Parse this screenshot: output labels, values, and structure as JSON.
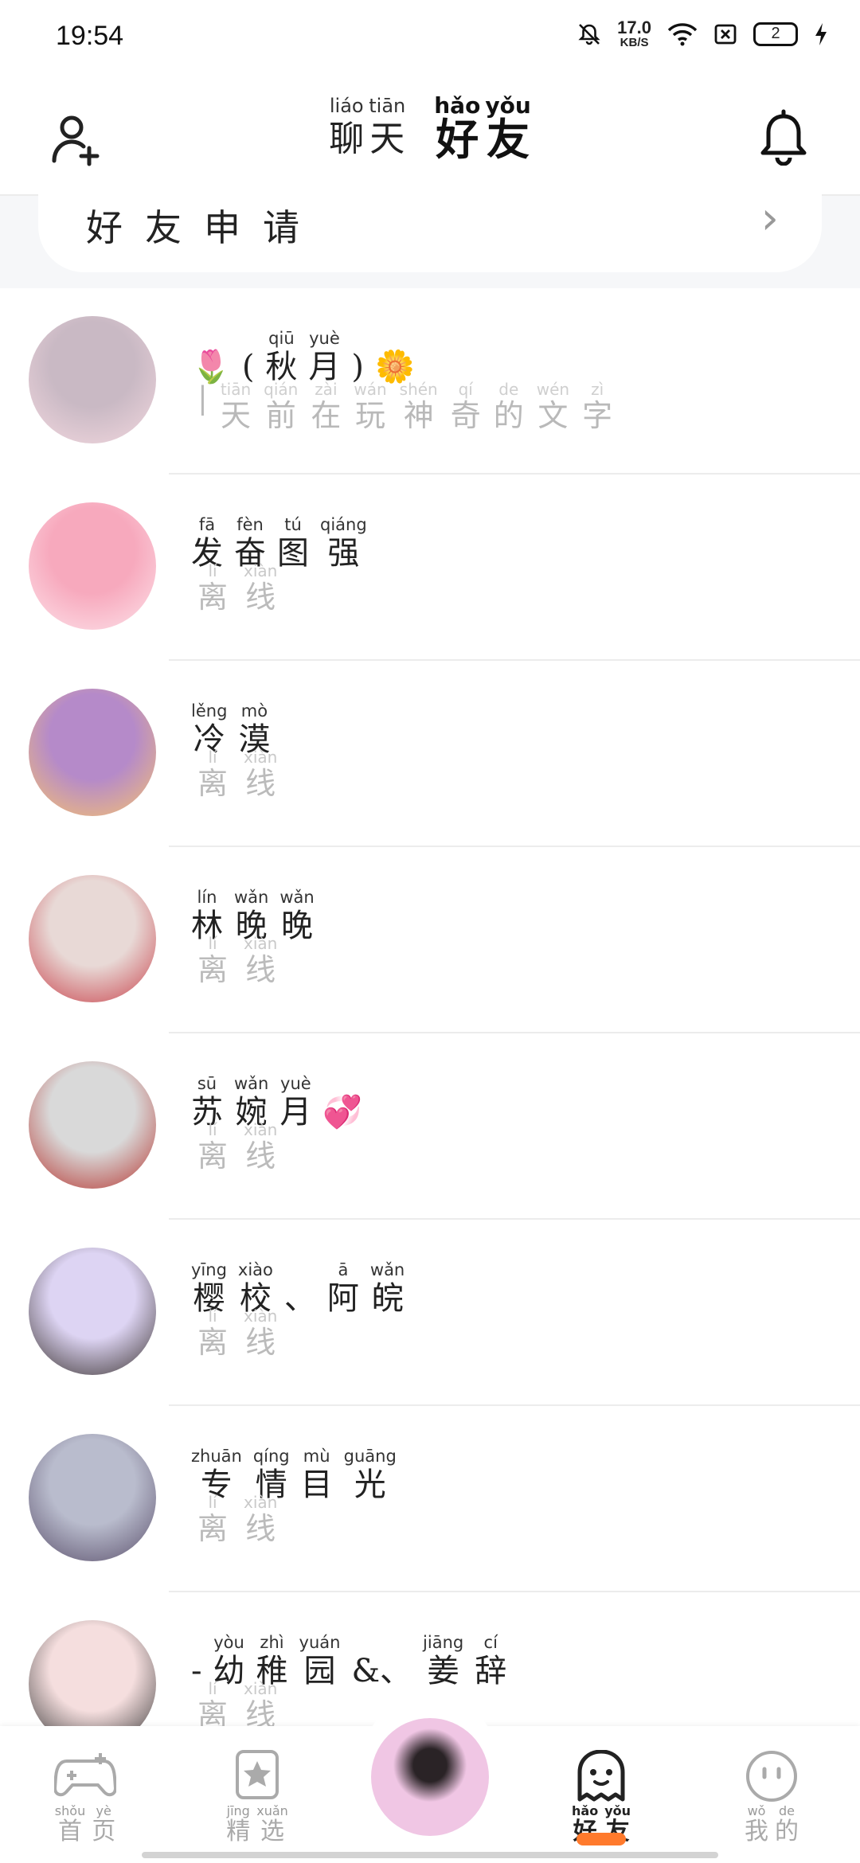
{
  "status_bar": {
    "time": "19:54",
    "net_speed_value": "17.0",
    "net_speed_unit": "KB/S",
    "battery_level": "2",
    "icons": [
      "bell-muted-icon",
      "wifi-icon",
      "sim-off-icon",
      "battery-icon",
      "charging-icon"
    ]
  },
  "header": {
    "tabs": [
      {
        "chars": [
          {
            "py": "liáo",
            "hz": "聊"
          },
          {
            "py": "tiān",
            "hz": "天"
          }
        ],
        "active": false
      },
      {
        "chars": [
          {
            "py": "hǎo",
            "hz": "好"
          },
          {
            "py": "yǒu",
            "hz": "友"
          }
        ],
        "active": true
      }
    ],
    "left_icon": "add-friend-icon",
    "right_icon": "bell-icon",
    "accent_color": "#ff5a1f"
  },
  "friend_request": {
    "label": "好友申请",
    "arrow": "›"
  },
  "friends": [
    {
      "name": [
        {
          "py": "",
          "hz": "🌷"
        },
        {
          "py": "",
          "hz": "("
        },
        {
          "py": "qiū",
          "hz": "秋"
        },
        {
          "py": "yuè",
          "hz": "月"
        },
        {
          "py": "",
          "hz": ")"
        },
        {
          "py": "",
          "hz": "🌼"
        }
      ],
      "status": [
        {
          "py": "",
          "hz": "|"
        },
        {
          "py": "tiān",
          "hz": "天"
        },
        {
          "py": "qián",
          "hz": "前"
        },
        {
          "py": "zài",
          "hz": "在"
        },
        {
          "py": "wán",
          "hz": "玩"
        },
        {
          "py": "shén",
          "hz": "神"
        },
        {
          "py": "qí",
          "hz": "奇"
        },
        {
          "py": "de",
          "hz": "的"
        },
        {
          "py": "wén",
          "hz": "文"
        },
        {
          "py": "zì",
          "hz": "字"
        }
      ],
      "avatar_colors": [
        "#c9b9c4",
        "#f3d8df"
      ]
    },
    {
      "name": [
        {
          "py": "fā",
          "hz": "发"
        },
        {
          "py": "fèn",
          "hz": "奋"
        },
        {
          "py": "tú",
          "hz": "图"
        },
        {
          "py": "qiáng",
          "hz": "强"
        }
      ],
      "status": [
        {
          "py": "lí",
          "hz": "离"
        },
        {
          "py": "xiàn",
          "hz": "线"
        }
      ],
      "avatar_colors": [
        "#f7a9bd",
        "#fde3ea"
      ]
    },
    {
      "name": [
        {
          "py": "lěng",
          "hz": "冷"
        },
        {
          "py": "mò",
          "hz": "漠"
        }
      ],
      "status": [
        {
          "py": "lí",
          "hz": "离"
        },
        {
          "py": "xiàn",
          "hz": "线"
        }
      ],
      "avatar_colors": [
        "#b58ac9",
        "#f6c270"
      ]
    },
    {
      "name": [
        {
          "py": "lín",
          "hz": "林"
        },
        {
          "py": "wǎn",
          "hz": "晚"
        },
        {
          "py": "wǎn",
          "hz": "晚"
        }
      ],
      "status": [
        {
          "py": "lí",
          "hz": "离"
        },
        {
          "py": "xiàn",
          "hz": "线"
        }
      ],
      "avatar_colors": [
        "#e8d9d6",
        "#c8414a"
      ]
    },
    {
      "name": [
        {
          "py": "sū",
          "hz": "苏"
        },
        {
          "py": "wǎn",
          "hz": "婉"
        },
        {
          "py": "yuè",
          "hz": "月"
        },
        {
          "py": "",
          "hz": "💞"
        }
      ],
      "status": [
        {
          "py": "lí",
          "hz": "离"
        },
        {
          "py": "xiàn",
          "hz": "线"
        }
      ],
      "avatar_colors": [
        "#d9d9d9",
        "#b5332e"
      ]
    },
    {
      "name": [
        {
          "py": "yīng",
          "hz": "樱"
        },
        {
          "py": "xiào",
          "hz": "校"
        },
        {
          "py": "",
          "hz": "、"
        },
        {
          "py": "ā",
          "hz": "阿"
        },
        {
          "py": "wǎn",
          "hz": "皖"
        }
      ],
      "status": [
        {
          "py": "lí",
          "hz": "离"
        },
        {
          "py": "xiàn",
          "hz": "线"
        }
      ],
      "avatar_colors": [
        "#ddd4f3",
        "#3a3230"
      ]
    },
    {
      "name": [
        {
          "py": "zhuān",
          "hz": "专"
        },
        {
          "py": "qíng",
          "hz": "情"
        },
        {
          "py": "mù",
          "hz": "目"
        },
        {
          "py": "guāng",
          "hz": "光"
        }
      ],
      "status": [
        {
          "py": "lí",
          "hz": "离"
        },
        {
          "py": "xiàn",
          "hz": "线"
        }
      ],
      "avatar_colors": [
        "#b9bccd",
        "#5a4f6b"
      ]
    },
    {
      "name": [
        {
          "py": "",
          "hz": "-"
        },
        {
          "py": "yòu",
          "hz": "幼"
        },
        {
          "py": "zhì",
          "hz": "稚"
        },
        {
          "py": "yuán",
          "hz": "园"
        },
        {
          "py": "",
          "hz": "&、"
        },
        {
          "py": "jiāng",
          "hz": "姜"
        },
        {
          "py": "cí",
          "hz": "辞"
        }
      ],
      "status": [
        {
          "py": "lí",
          "hz": "离"
        },
        {
          "py": "xiàn",
          "hz": "线"
        }
      ],
      "avatar_colors": [
        "#f5dede",
        "#333333"
      ]
    }
  ],
  "bottom_nav": {
    "items": [
      {
        "key": "home",
        "icon": "gamepad-icon",
        "label": [
          {
            "py": "shǒu",
            "hz": "首"
          },
          {
            "py": "yè",
            "hz": "页"
          }
        ],
        "active": false
      },
      {
        "key": "featured",
        "icon": "star-bookmark-icon",
        "label": [
          {
            "py": "jīng",
            "hz": "精"
          },
          {
            "py": "xuǎn",
            "hz": "选"
          }
        ],
        "active": false
      },
      {
        "key": "friends",
        "icon": "ghost-icon",
        "label": [
          {
            "py": "hǎo",
            "hz": "好"
          },
          {
            "py": "yǒu",
            "hz": "友"
          }
        ],
        "active": true
      },
      {
        "key": "mine",
        "icon": "smiley-icon",
        "label": [
          {
            "py": "wǒ",
            "hz": "我"
          },
          {
            "py": "de",
            "hz": "的"
          }
        ],
        "active": false
      }
    ],
    "center_avatar_colors": [
      "#f0c6e4",
      "#2a2326"
    ],
    "accent_color": "#ff7a2c"
  }
}
